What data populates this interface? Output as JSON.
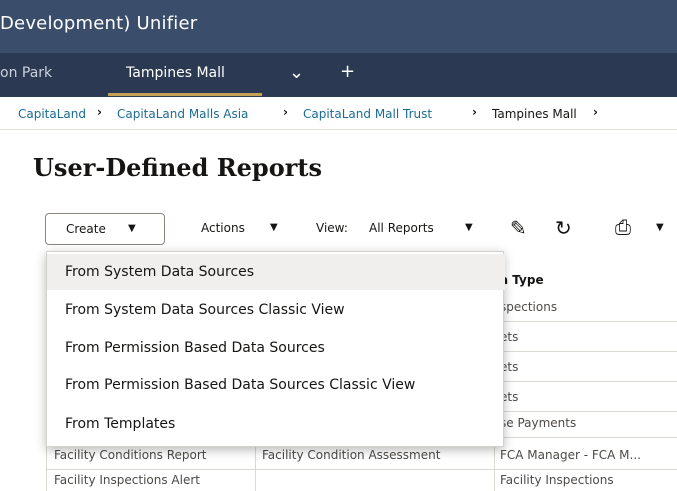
{
  "window": {
    "title": "Development)  Unifier"
  },
  "tabs": [
    {
      "label": "on Park",
      "active": false
    },
    {
      "label": "Tampines Mall",
      "active": true
    }
  ],
  "tab_actions": {
    "dropdown_icon": "chevron-down-icon",
    "add_icon": "plus-icon"
  },
  "breadcrumb": [
    "CapitaLand",
    "CapitaLand Malls Asia",
    "CapitaLand Mall Trust",
    "Tampines Mall"
  ],
  "page": {
    "title": "User-Defined Reports"
  },
  "toolbar": {
    "create_label": "Create",
    "actions_label": "Actions",
    "view_label": "View:",
    "view_value": "All Reports",
    "icons": [
      "edit-icon",
      "refresh-icon",
      "print-icon"
    ]
  },
  "table": {
    "visible_header": "a Type",
    "rows": [
      {
        "col1": "",
        "col2": "",
        "col3": "spections"
      },
      {
        "col1": "",
        "col2": "",
        "col3": "ets"
      },
      {
        "col1": "",
        "col2": "",
        "col3": "ets"
      },
      {
        "col1": "",
        "col2": "",
        "col3": "ets"
      },
      {
        "col1": "",
        "col2": "",
        "col3": "se Payments"
      },
      {
        "col1": "Facility Conditions Report",
        "col2": "Facility Condition Assessment",
        "col3": "FCA Manager - FCA M..."
      },
      {
        "col1": "Facility Inspections Alert",
        "col2": "",
        "col3": "Facility Inspections"
      }
    ]
  },
  "create_menu": {
    "items": [
      "From System Data Sources",
      "From System Data Sources Classic View",
      "From Permission Based Data Sources",
      "From Permission Based Data Sources Classic View",
      "From Templates"
    ],
    "highlighted_index": 0
  },
  "colors": {
    "titlebar": "#3a4d6b",
    "tabbar": "#2b3a52",
    "active_tab_underline": "#c4a055",
    "link": "#1b6b93"
  }
}
